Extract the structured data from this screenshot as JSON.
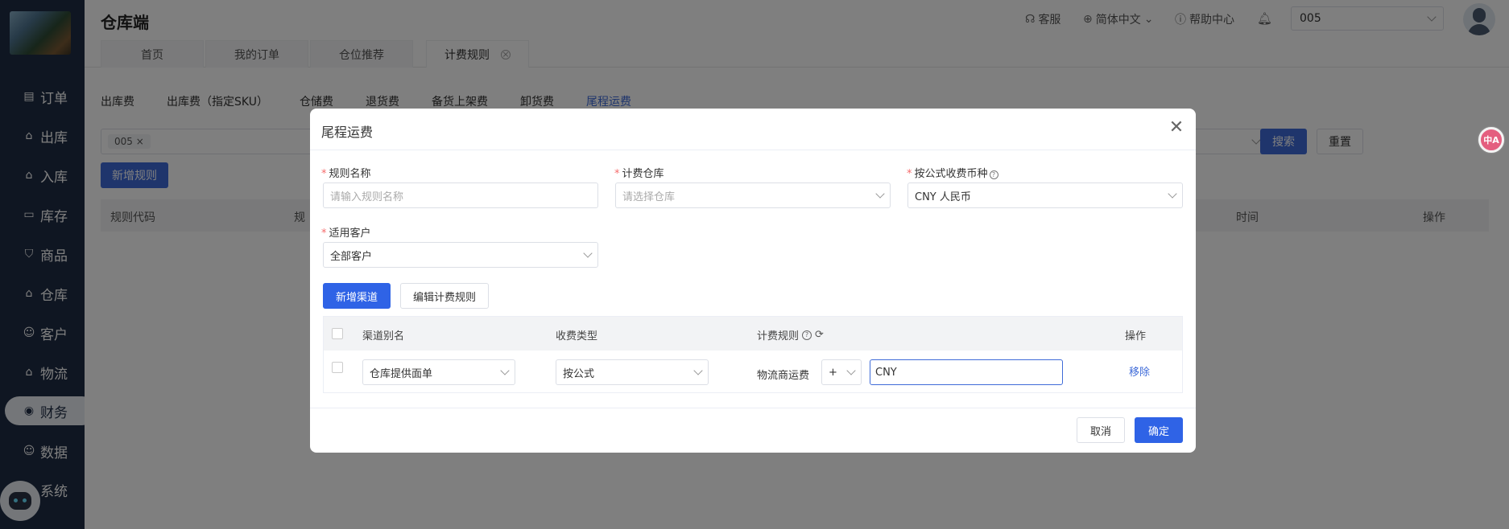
{
  "app": {
    "title": "仓库端"
  },
  "sidebar": {
    "items": [
      {
        "label": "订单",
        "icon": "order-icon"
      },
      {
        "label": "出库",
        "icon": "outbound-icon"
      },
      {
        "label": "入库",
        "icon": "inbound-icon"
      },
      {
        "label": "库存",
        "icon": "inventory-icon"
      },
      {
        "label": "商品",
        "icon": "goods-icon"
      },
      {
        "label": "仓库",
        "icon": "warehouse-icon"
      },
      {
        "label": "客户",
        "icon": "customer-icon"
      },
      {
        "label": "物流",
        "icon": "logistics-icon"
      },
      {
        "label": "财务",
        "icon": "finance-icon",
        "active": true
      },
      {
        "label": "数据",
        "icon": "data-icon"
      },
      {
        "label": "系统",
        "icon": "system-icon"
      }
    ]
  },
  "header": {
    "support": "客服",
    "language": "简体中文",
    "help": "帮助中心",
    "account_code": "005"
  },
  "page_tabs": [
    {
      "label": "首页"
    },
    {
      "label": "我的订单"
    },
    {
      "label": "仓位推荐"
    },
    {
      "label": "计费规则",
      "active": true,
      "closable": true
    }
  ],
  "content": {
    "sub_tabs": [
      "出库费",
      "出库费（指定SKU）",
      "仓储费",
      "退货费",
      "备货上架费",
      "卸货费",
      "尾程运费"
    ],
    "active_sub_tab": "尾程运费",
    "filter_chip": "005",
    "search_label": "搜索",
    "reset_label": "重置",
    "add_rule_label": "新增规则",
    "table_headers": [
      "规则代码",
      "规",
      "时间",
      "操作"
    ]
  },
  "float_lang": "中A",
  "modal": {
    "title": "尾程运费",
    "fields": {
      "rule_name": {
        "label": "规则名称",
        "placeholder": "请输入规则名称"
      },
      "warehouse": {
        "label": "计费仓库",
        "placeholder": "请选择仓库"
      },
      "currency": {
        "label": "按公式收费币种",
        "value": "CNY 人民币"
      },
      "customer": {
        "label": "适用客户",
        "value": "全部客户"
      }
    },
    "add_channel_label": "新增渠道",
    "edit_rule_label": "编辑计费规则",
    "table": {
      "headers": {
        "alias": "渠道别名",
        "type": "收费类型",
        "rule": "计费规则",
        "op": "操作"
      },
      "rows": [
        {
          "alias": "仓库提供面单",
          "type": "按公式",
          "rule_label": "物流商运费",
          "operator": "+",
          "value": "CNY",
          "action": "移除"
        }
      ]
    },
    "cancel_label": "取消",
    "confirm_label": "确定"
  },
  "colors": {
    "sidebar_bg": "#1f2d45",
    "primary": "#2f63e6",
    "required": "#f56c6c",
    "link": "#3f6bd8"
  }
}
